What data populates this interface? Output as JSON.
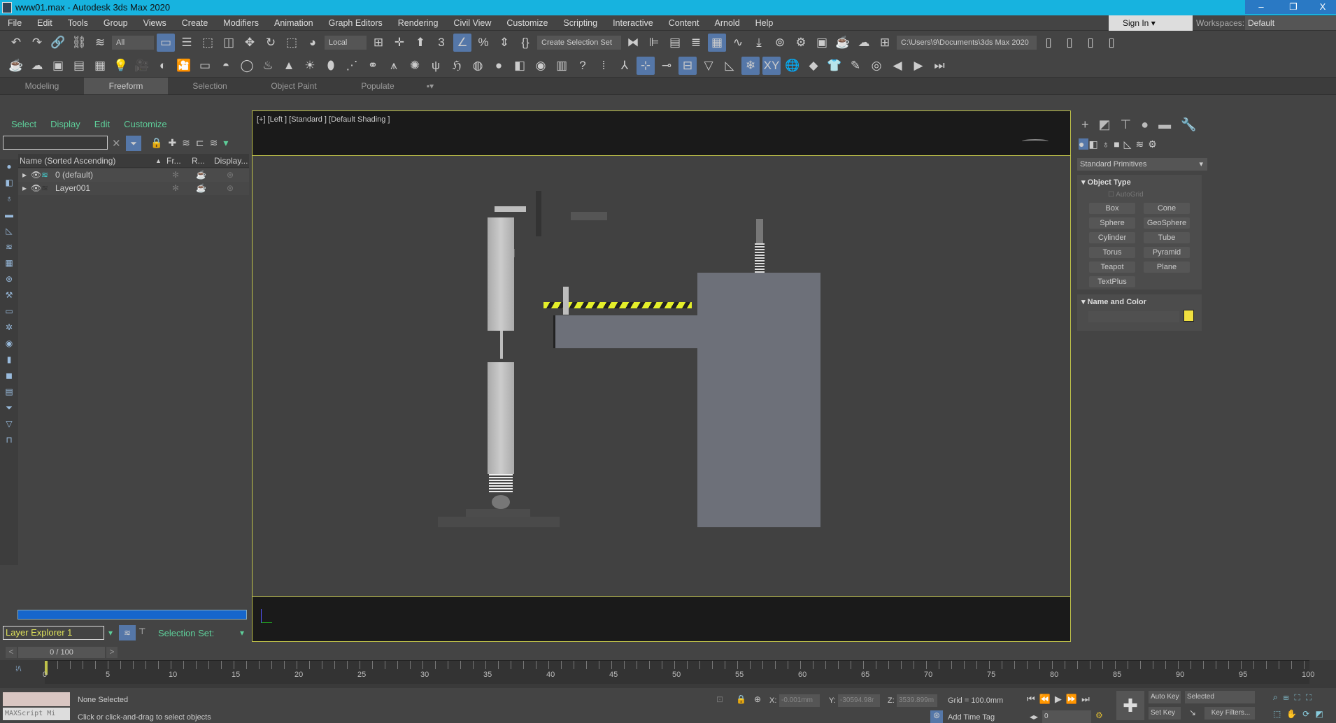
{
  "title": "www01.max - Autodesk 3ds Max 2020",
  "window_buttons": [
    "–",
    "❐",
    "X"
  ],
  "menu": [
    "File",
    "Edit",
    "Tools",
    "Group",
    "Views",
    "Create",
    "Modifiers",
    "Animation",
    "Graph Editors",
    "Rendering",
    "Civil View",
    "Customize",
    "Scripting",
    "Interactive",
    "Content",
    "Arnold",
    "Help"
  ],
  "signin": "Sign In",
  "workspaces_label": "Workspaces:",
  "workspaces_value": "Default",
  "toolbar1": {
    "filter": "All",
    "coord": "Local",
    "selset": "Create Selection Set",
    "path": "C:\\Users\\9\\Documents\\3ds Max 2020"
  },
  "ribbon_tabs": [
    "Modeling",
    "Freeform",
    "Selection",
    "Object Paint",
    "Populate"
  ],
  "scene_explorer": {
    "menu": [
      "Select",
      "Display",
      "Edit",
      "Customize"
    ],
    "search_value": "",
    "columns": [
      "Name (Sorted Ascending)",
      "Fr...",
      "R...",
      "Display..."
    ],
    "rows": [
      "0 (default)",
      "Layer001"
    ],
    "explorer_name": "Layer Explorer 1",
    "selection_set": "Selection Set:"
  },
  "viewport": {
    "label": "[+] [Left ] [Standard ] [Default Shading ]"
  },
  "command_panel": {
    "dropdown": "Standard Primitives",
    "object_type": "Object Type",
    "autogrid": "AutoGrid",
    "buttons": [
      "Box",
      "Cone",
      "Sphere",
      "GeoSphere",
      "Cylinder",
      "Tube",
      "Torus",
      "Pyramid",
      "Teapot",
      "Plane",
      "TextPlus"
    ],
    "name_color": "Name and Color",
    "name_value": "",
    "color": "#f0e040"
  },
  "time": {
    "frame": "0 / 100",
    "ticks": [
      "0",
      "5",
      "10",
      "15",
      "20",
      "25",
      "30",
      "35",
      "40",
      "45",
      "50",
      "55",
      "60",
      "65",
      "70",
      "75",
      "80",
      "85",
      "90",
      "95",
      "100"
    ],
    "progress": 0
  },
  "status": {
    "maxscript": "MAXScript Mi",
    "selected": "None Selected",
    "prompt": "Click or click-and-drag to select objects",
    "x": "-0.001mm",
    "y": "-30594.98r",
    "z": "3539.899m",
    "grid": "Grid = 100.0mm",
    "add_time_tag": "Add Time Tag",
    "auto_key": "Auto Key",
    "set_key": "Set Key",
    "key_mode": "Selected",
    "key_filters": "Key Filters...",
    "frame_field": "0"
  }
}
